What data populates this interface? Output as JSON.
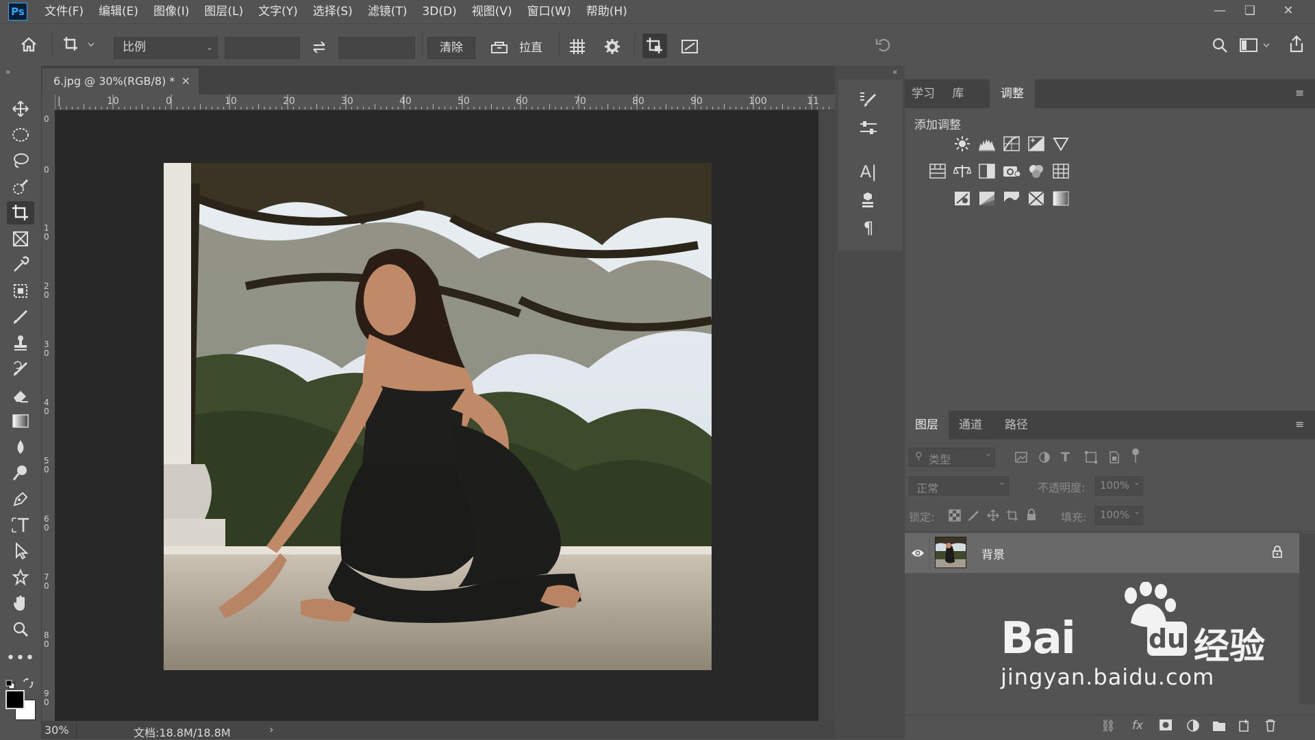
{
  "app": {
    "logo": "Ps"
  },
  "menu": [
    "文件(F)",
    "编辑(E)",
    "图像(I)",
    "图层(L)",
    "文字(Y)",
    "选择(S)",
    "滤镜(T)",
    "3D(D)",
    "视图(V)",
    "窗口(W)",
    "帮助(H)"
  ],
  "options": {
    "ratio_select": "比例",
    "width_value": "",
    "height_value": "",
    "clear_label": "清除",
    "straighten_label": "拉直"
  },
  "document": {
    "tab_title": "6.jpg @ 30%(RGB/8) *",
    "ruler_h_labels": [
      "10",
      "0",
      "10",
      "20",
      "30",
      "40",
      "50",
      "60",
      "70",
      "80",
      "90",
      "100",
      "11"
    ],
    "ruler_v_labels": [
      "0",
      "0",
      "1\n0",
      "2\n0",
      "3\n0",
      "4\n0",
      "5\n0",
      "6\n0",
      "7\n0",
      "8\n0",
      "9\n0"
    ],
    "zoom": "30%",
    "doc_size": "文档:18.8M/18.8M"
  },
  "adjust_panel": {
    "tabs": [
      "学习",
      "库",
      "调整"
    ],
    "active_tab": "调整",
    "heading": "添加调整",
    "row1": [
      "brightness-icon",
      "levels-icon",
      "curves-icon",
      "exposure-icon",
      "vibrance-icon"
    ],
    "row2": [
      "hue-saturation-icon",
      "color-balance-icon",
      "black-white-icon",
      "photo-filter-icon",
      "channel-mixer-icon",
      "color-lookup-icon"
    ],
    "row3": [
      "invert-icon",
      "posterize-icon",
      "threshold-icon",
      "selective-color-icon",
      "gradient-map-icon"
    ]
  },
  "layers_panel": {
    "tabs": [
      "图层",
      "通道",
      "路径"
    ],
    "active_tab": "图层",
    "filter_placeholder": "类型",
    "blend_mode": "正常",
    "opacity_label": "不透明度:",
    "opacity_value": "100%",
    "lock_label": "锁定:",
    "fill_label": "填充:",
    "fill_value": "100%",
    "layers": [
      {
        "name": "背景",
        "visible": true,
        "locked": true
      }
    ]
  },
  "watermark": {
    "brand": "Bai",
    "brand2": "经验",
    "url": "jingyan.baidu.com"
  },
  "colors": {
    "accent": "#31a8ff",
    "panel": "#535353",
    "canvas": "#282828",
    "selected_layer": "#696969"
  }
}
